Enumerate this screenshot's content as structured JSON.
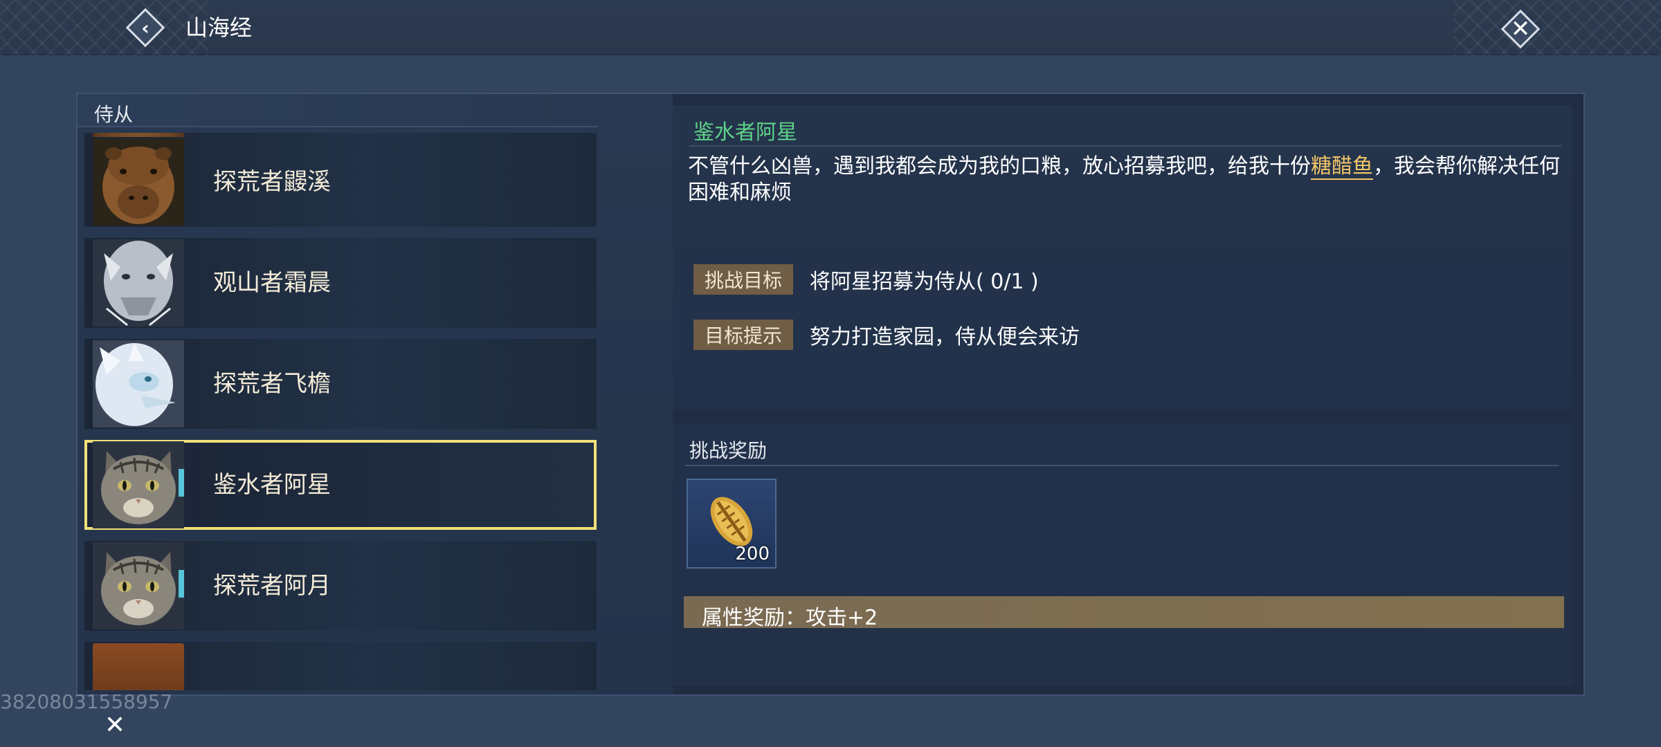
{
  "header": {
    "title": "山海经",
    "back_icon": "chevron-left-icon",
    "close_icon": "close-icon"
  },
  "left": {
    "section_title": "侍从",
    "companions": [
      {
        "name": "探荒者鼹溪",
        "portrait": "capybara-portrait"
      },
      {
        "name": "观山者霜晨",
        "portrait": "silver-beast-portrait"
      },
      {
        "name": "探荒者飞檐",
        "portrait": "white-dragon-portrait"
      },
      {
        "name": "鉴水者阿星",
        "portrait": "tabby-cat-portrait",
        "selected": true
      },
      {
        "name": "探荒者阿月",
        "portrait": "tabby-cat-portrait"
      }
    ]
  },
  "detail": {
    "npc_name": "鉴水者阿星",
    "quote_before": "不管什么凶兽，遇到我都会成为我的口粮，放心招募我吧，给我十份",
    "quote_highlight": "糖醋鱼",
    "quote_after": "，我会帮你解决任何困难和麻烦",
    "goal_tag": "挑战目标",
    "goal_text": "将阿星招募为侍从( 0/1 )",
    "hint_tag": "目标提示",
    "hint_text": "努力打造家园，侍从便会来访"
  },
  "reward": {
    "title": "挑战奖励",
    "item_icon": "gold-shell-icon",
    "item_count": "200",
    "attr_text": "属性奖励：攻击+2"
  },
  "overlay": {
    "uid": "38208031558957",
    "close_icon": "close-icon"
  },
  "colors": {
    "background": "#33445f",
    "panel": "#1f2c41",
    "name_green": "#5fd28a",
    "highlight_gold": "#f2c569",
    "selection_yellow": "#f2e07a",
    "tag_brown": "#6f5d45"
  }
}
